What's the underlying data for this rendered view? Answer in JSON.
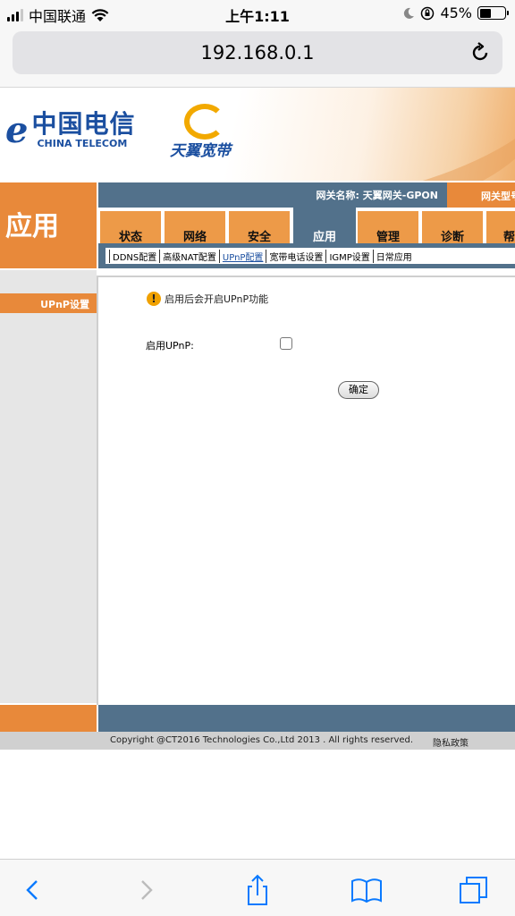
{
  "status_bar": {
    "carrier": "中国联通",
    "time": "上午1:11",
    "battery": "45%"
  },
  "browser": {
    "url": "192.168.0.1"
  },
  "banner": {
    "ct_cn": "中国电信",
    "ct_en": "CHINA TELECOM",
    "tianyi": "天翼宽带"
  },
  "header": {
    "section_title": "应用",
    "gateway_label": "网关名称:  天翼网关-GPON",
    "gateway_model": "网关型号"
  },
  "tabs": [
    {
      "label": "状态"
    },
    {
      "label": "网络"
    },
    {
      "label": "安全"
    },
    {
      "label": "应用"
    },
    {
      "label": "管理"
    },
    {
      "label": "诊断"
    },
    {
      "label": "帮"
    }
  ],
  "subnav": [
    {
      "label": "DDNS配置"
    },
    {
      "label": "高级NAT配置"
    },
    {
      "label": "UPnP配置"
    },
    {
      "label": "宽带电话设置"
    },
    {
      "label": "IGMP设置"
    },
    {
      "label": "日常应用"
    }
  ],
  "sidebar": {
    "item": "UPnP设置"
  },
  "content": {
    "warning": "启用后会开启UPnP功能",
    "enable_label": "启用UPnP:",
    "ok_button": "确定"
  },
  "footer": {
    "copyright": "Copyright @CT2016 Technologies Co.,Ltd 2013 . All rights reserved.",
    "privacy": "隐私政策"
  },
  "colors": {
    "orange": "#e8893a",
    "blue": "#52718b"
  },
  "toolbar_icons": [
    "back-icon",
    "forward-icon",
    "share-icon",
    "bookmarks-icon",
    "tabs-icon"
  ]
}
